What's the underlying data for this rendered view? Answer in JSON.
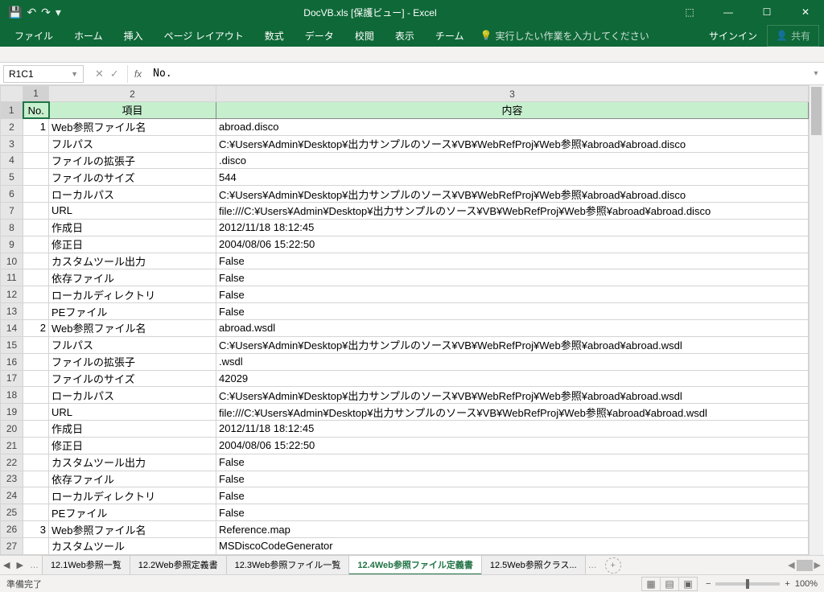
{
  "title": "DocVB.xls  [保護ビュー] - Excel",
  "qat": {
    "save": "💾",
    "undo": "↶",
    "redo": "↷",
    "more": "▾"
  },
  "win": {
    "ribbon_opts": "⬚",
    "min": "—",
    "max": "☐",
    "close": "✕"
  },
  "ribbon": {
    "tabs": [
      "ファイル",
      "ホーム",
      "挿入",
      "ページ レイアウト",
      "数式",
      "データ",
      "校閲",
      "表示",
      "チーム"
    ],
    "tellme_icon": "💡",
    "tellme": "実行したい作業を入力してください",
    "signin": "サインイン",
    "share_icon": "👤",
    "share": "共有"
  },
  "name_box": "R1C1",
  "fb": {
    "cancel": "✕",
    "enter": "✓",
    "fx": "fx"
  },
  "formula": "No.",
  "col_headers": [
    "1",
    "2",
    "3"
  ],
  "header_row": {
    "no": "No.",
    "item": "項目",
    "content": "内容"
  },
  "rows": [
    {
      "r": "2",
      "no": "1",
      "item": "Web参照ファイル名",
      "content": "abroad.disco"
    },
    {
      "r": "3",
      "no": "",
      "item": "フルパス",
      "content": "C:¥Users¥Admin¥Desktop¥出力サンプルのソース¥VB¥WebRefProj¥Web参照¥abroad¥abroad.disco"
    },
    {
      "r": "4",
      "no": "",
      "item": "ファイルの拡張子",
      "content": ".disco"
    },
    {
      "r": "5",
      "no": "",
      "item": "ファイルのサイズ",
      "content": "544"
    },
    {
      "r": "6",
      "no": "",
      "item": "ローカルパス",
      "content": "C:¥Users¥Admin¥Desktop¥出力サンプルのソース¥VB¥WebRefProj¥Web参照¥abroad¥abroad.disco"
    },
    {
      "r": "7",
      "no": "",
      "item": "URL",
      "content": "file:///C:¥Users¥Admin¥Desktop¥出力サンプルのソース¥VB¥WebRefProj¥Web参照¥abroad¥abroad.disco"
    },
    {
      "r": "8",
      "no": "",
      "item": "作成日",
      "content": "2012/11/18 18:12:45"
    },
    {
      "r": "9",
      "no": "",
      "item": "修正日",
      "content": "2004/08/06 15:22:50"
    },
    {
      "r": "10",
      "no": "",
      "item": "カスタムツール出力",
      "content": "False"
    },
    {
      "r": "11",
      "no": "",
      "item": "依存ファイル",
      "content": "False"
    },
    {
      "r": "12",
      "no": "",
      "item": "ローカルディレクトリ",
      "content": "False"
    },
    {
      "r": "13",
      "no": "",
      "item": "PEファイル",
      "content": "False"
    },
    {
      "r": "14",
      "no": "2",
      "item": "Web参照ファイル名",
      "content": "abroad.wsdl"
    },
    {
      "r": "15",
      "no": "",
      "item": "フルパス",
      "content": "C:¥Users¥Admin¥Desktop¥出力サンプルのソース¥VB¥WebRefProj¥Web参照¥abroad¥abroad.wsdl"
    },
    {
      "r": "16",
      "no": "",
      "item": "ファイルの拡張子",
      "content": ".wsdl"
    },
    {
      "r": "17",
      "no": "",
      "item": "ファイルのサイズ",
      "content": "42029"
    },
    {
      "r": "18",
      "no": "",
      "item": "ローカルパス",
      "content": "C:¥Users¥Admin¥Desktop¥出力サンプルのソース¥VB¥WebRefProj¥Web参照¥abroad¥abroad.wsdl"
    },
    {
      "r": "19",
      "no": "",
      "item": "URL",
      "content": "file:///C:¥Users¥Admin¥Desktop¥出力サンプルのソース¥VB¥WebRefProj¥Web参照¥abroad¥abroad.wsdl"
    },
    {
      "r": "20",
      "no": "",
      "item": "作成日",
      "content": "2012/11/18 18:12:45"
    },
    {
      "r": "21",
      "no": "",
      "item": "修正日",
      "content": "2004/08/06 15:22:50"
    },
    {
      "r": "22",
      "no": "",
      "item": "カスタムツール出力",
      "content": "False"
    },
    {
      "r": "23",
      "no": "",
      "item": "依存ファイル",
      "content": "False"
    },
    {
      "r": "24",
      "no": "",
      "item": "ローカルディレクトリ",
      "content": "False"
    },
    {
      "r": "25",
      "no": "",
      "item": "PEファイル",
      "content": "False"
    },
    {
      "r": "26",
      "no": "3",
      "item": "Web参照ファイル名",
      "content": "Reference.map"
    },
    {
      "r": "27",
      "no": "",
      "item": "カスタムツール",
      "content": "MSDiscoCodeGenerator"
    }
  ],
  "sheets": {
    "nav_prev": "◀",
    "nav_next": "▶",
    "dots": "…",
    "tabs": [
      "12.1Web参照一覧",
      "12.2Web参照定義書",
      "12.3Web参照ファイル一覧",
      "12.4Web参照ファイル定義書",
      "12.5Web参照クラス..."
    ],
    "active": 3,
    "add": "+",
    "hscroll": {
      "left": "◀",
      "right": "▶"
    }
  },
  "status": {
    "ready": "準備完了",
    "zoom": "100%",
    "minus": "−",
    "plus": "+"
  }
}
